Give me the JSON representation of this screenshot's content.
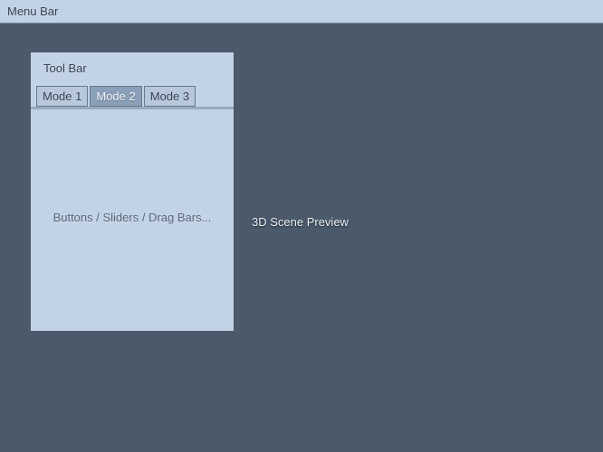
{
  "menubar": {
    "label": "Menu Bar"
  },
  "toolpanel": {
    "title": "Tool Bar",
    "tabs": [
      {
        "label": "Mode 1",
        "active": false
      },
      {
        "label": "Mode 2",
        "active": true
      },
      {
        "label": "Mode 3",
        "active": false
      }
    ],
    "body_placeholder": "Buttons / Sliders / Drag Bars..."
  },
  "scene": {
    "label": "3D Scene Preview"
  }
}
